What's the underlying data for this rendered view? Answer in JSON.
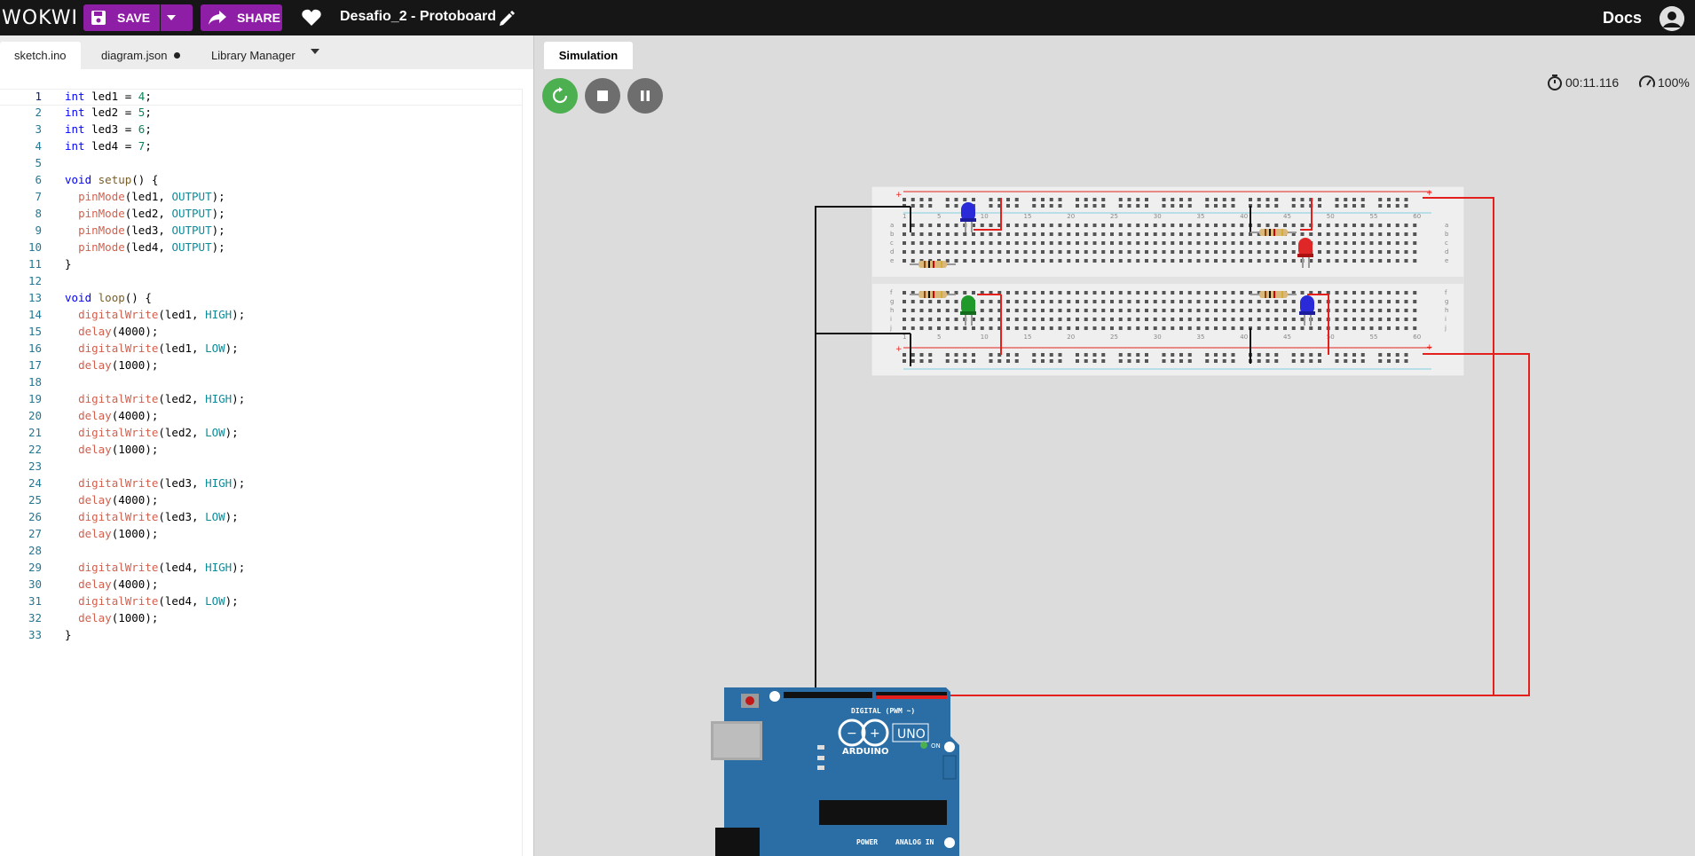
{
  "app": {
    "logo": "WOKWI",
    "project_title": "Desafio_2 - Protoboard",
    "docs_label": "Docs"
  },
  "toolbar": {
    "save_label": "SAVE",
    "share_label": "SHARE"
  },
  "editor": {
    "tabs": [
      {
        "label": "sketch.ino",
        "active": true
      },
      {
        "label": "diagram.json",
        "modified": true
      },
      {
        "label": "Library Manager"
      }
    ],
    "lines": [
      "int led1 = 4;",
      "int led2 = 5;",
      "int led3 = 6;",
      "int led4 = 7;",
      "",
      "void setup() {",
      "  pinMode(led1, OUTPUT);",
      "  pinMode(led2, OUTPUT);",
      "  pinMode(led3, OUTPUT);",
      "  pinMode(led4, OUTPUT);",
      "}",
      "",
      "void loop() {",
      "  digitalWrite(led1, HIGH);",
      "  delay(4000);",
      "  digitalWrite(led1, LOW);",
      "  delay(1000);",
      "",
      "  digitalWrite(led2, HIGH);",
      "  delay(4000);",
      "  digitalWrite(led2, LOW);",
      "  delay(1000);",
      "",
      "  digitalWrite(led3, HIGH);",
      "  delay(4000);",
      "  digitalWrite(led3, LOW);",
      "  delay(1000);",
      "",
      "  digitalWrite(led4, HIGH);",
      "  delay(4000);",
      "  digitalWrite(led4, LOW);",
      "  delay(1000);",
      "}"
    ],
    "current_line": 1
  },
  "simulation": {
    "tab_label": "Simulation",
    "elapsed": "00:11.116",
    "speed": "100%",
    "board": {
      "model": "UNO",
      "brand": "ARDUINO",
      "on_label": "ON",
      "digital_label": "DIGITAL (PWM ~)",
      "analog_label": "ANALOG IN",
      "power_label": "POWER"
    },
    "breadboard": {
      "column_labels": [
        "1",
        "5",
        "10",
        "15",
        "20",
        "25",
        "30",
        "35",
        "40",
        "45",
        "50",
        "55",
        "60"
      ],
      "row_labels_top": [
        "a",
        "b",
        "c",
        "d",
        "e"
      ],
      "row_labels_bottom": [
        "f",
        "g",
        "h",
        "i",
        "j"
      ]
    },
    "leds": [
      {
        "color": "blue",
        "lit": false
      },
      {
        "color": "red",
        "lit": false
      },
      {
        "color": "green",
        "lit": false
      },
      {
        "color": "blue",
        "lit": false
      }
    ],
    "colors": {
      "wire_red": "#e3201b",
      "wire_black": "#111111",
      "accent_purple": "#8f1ea6",
      "restart_green": "#4caf50"
    }
  }
}
